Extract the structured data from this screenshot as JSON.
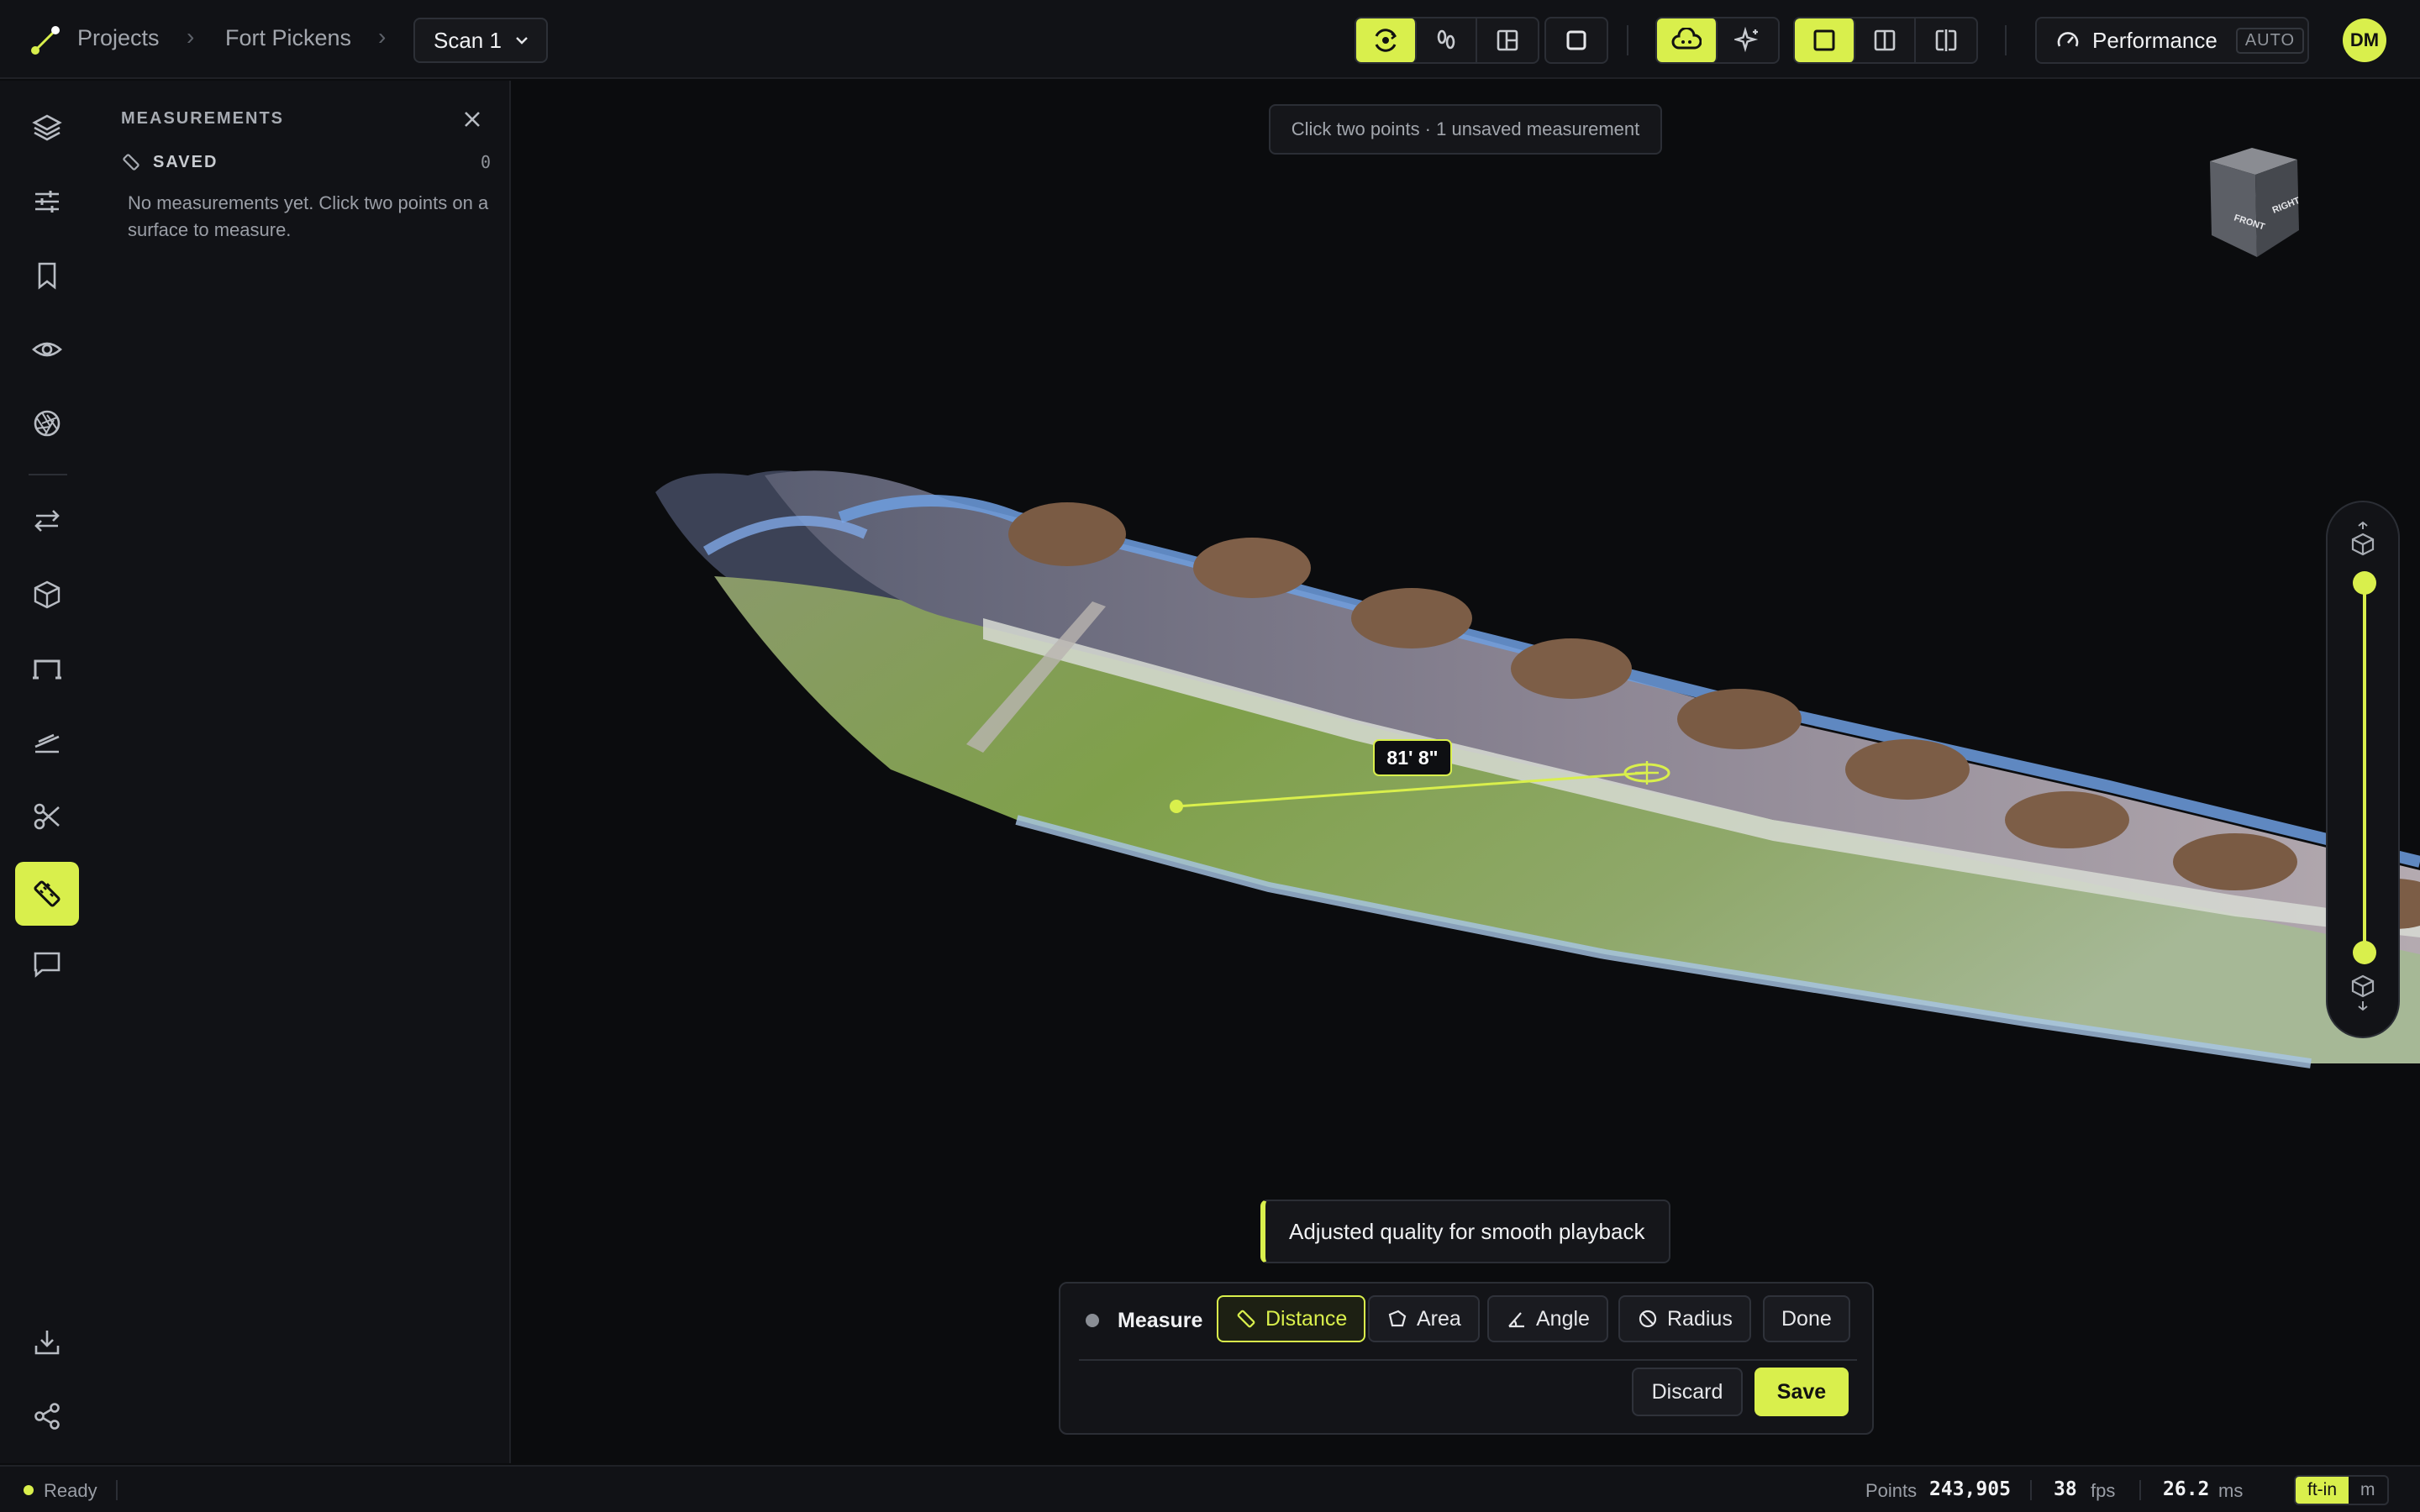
{
  "breadcrumb": {
    "projects": "Projects",
    "project": "Fort Pickens",
    "scan": "Scan 1"
  },
  "header": {
    "performance_label": "Performance",
    "performance_mode": "AUTO",
    "avatar_initials": "DM"
  },
  "toolbar_icons": [
    "orbit-icon",
    "walk-icon",
    "layout-icon",
    "square-icon",
    "cloud-icon",
    "sparkle-icon",
    "single-view-icon",
    "split-view-icon",
    "compare-view-icon"
  ],
  "sidebar_icons": [
    "layers-icon",
    "sliders-icon",
    "bookmark-icon",
    "eye-icon",
    "aperture-icon",
    "transfer-icon",
    "cube-icon",
    "section-icon",
    "terrain-icon",
    "scissors-icon",
    "ruler-icon",
    "comment-icon",
    "download-icon",
    "share-icon"
  ],
  "panel": {
    "title": "MEASUREMENTS",
    "saved_label": "SAVED",
    "saved_count": "0",
    "empty_text": "No measurements yet. Click two points on a surface to measure."
  },
  "viewport": {
    "hint": "Click two points · 1 unsaved measurement",
    "measurement_label": "81' 8\"",
    "navcube_front": "FRONT",
    "navcube_right": "RIGHT",
    "toast": "Adjusted quality for smooth playback"
  },
  "measure_toolbar": {
    "title": "Measure",
    "tools": {
      "distance": "Distance",
      "area": "Area",
      "angle": "Angle",
      "radius": "Radius"
    },
    "done": "Done",
    "discard": "Discard",
    "save": "Save"
  },
  "status": {
    "state": "Ready",
    "points_label": "Points",
    "points_value": "243,905",
    "fps_value": "38",
    "fps_label": "fps",
    "ms_value": "26.2",
    "ms_label": "ms",
    "unit_imperial": "ft-in",
    "unit_metric": "m"
  },
  "colors": {
    "accent": "#d9ef4c",
    "background": "#0b0c0e",
    "panel": "#111216"
  }
}
